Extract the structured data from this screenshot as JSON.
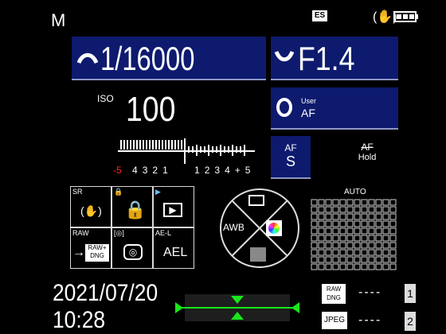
{
  "mode": "M",
  "top_right": {
    "es_badge": "ES",
    "stabilizer_icon": "hand-shake-icon",
    "battery_icon": "battery-icon"
  },
  "shutter": {
    "value": "1/16000",
    "icon": "shutter-dial-icon"
  },
  "aperture": {
    "value": "F1.4",
    "icon": "aperture-dial-icon"
  },
  "iso": {
    "label": "ISO",
    "value": "100"
  },
  "af_mode": {
    "line1": "User",
    "line2": "AF",
    "icon": "af-ring-icon"
  },
  "exposure_scale": {
    "minus_label": "-5",
    "labels_left": [
      "4",
      "3",
      "2",
      "1"
    ],
    "labels_right": [
      "1",
      "2",
      "3",
      "4",
      "+5"
    ]
  },
  "af_buttons": {
    "af_s_top": "AF",
    "af_s_bottom": "S",
    "af_hold_top": "AF",
    "af_hold_bottom": "Hold"
  },
  "quick_grid": {
    "sr_label": "SR",
    "lock_label": "🔒",
    "play_label": "▶",
    "raw_label": "RAW",
    "raw_dng_label": "RAW+\nDNG",
    "aei_label": "AE-L",
    "ael_value": "AEL"
  },
  "dial": {
    "awb_label": "AWB"
  },
  "auto_label": "AUTO",
  "datetime": {
    "date": "2021/07/20",
    "time": "10:28"
  },
  "storage": [
    {
      "format": "RAW\nDNG",
      "count": "----",
      "slot": "1"
    },
    {
      "format": "JPEG",
      "count": "----",
      "slot": "2"
    }
  ],
  "colors": {
    "accent_blue": "#0d1a6e",
    "level_green": "#19e619",
    "scale_red": "#ff2a2a"
  }
}
